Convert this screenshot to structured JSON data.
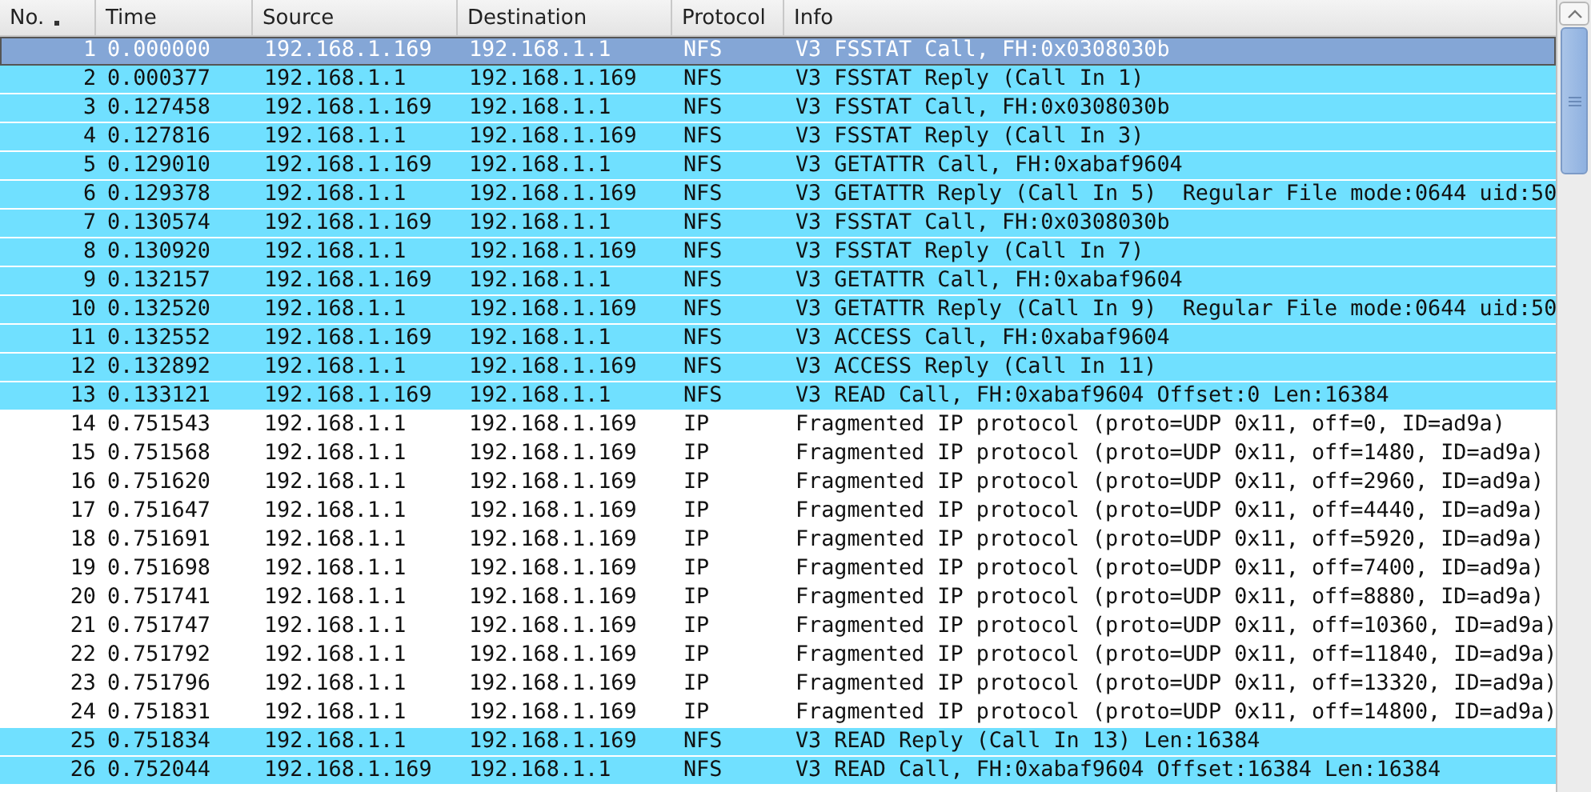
{
  "table": {
    "columns": [
      {
        "label": "No.",
        "sorted": true
      },
      {
        "label": "Time",
        "sorted": false
      },
      {
        "label": "Source",
        "sorted": false
      },
      {
        "label": "Destination",
        "sorted": false
      },
      {
        "label": "Protocol",
        "sorted": false
      },
      {
        "label": "Info",
        "sorted": false
      }
    ],
    "rows": [
      {
        "no": "1",
        "time": "0.000000",
        "source": "192.168.1.169",
        "destination": "192.168.1.1",
        "protocol": "NFS",
        "info": "V3 FSSTAT Call, FH:0x0308030b",
        "color": "#84a6d6",
        "selected": true
      },
      {
        "no": "2",
        "time": "0.000377",
        "source": "192.168.1.1",
        "destination": "192.168.1.169",
        "protocol": "NFS",
        "info": "V3 FSSTAT Reply (Call In 1)",
        "color": "#70e0ff",
        "selected": false
      },
      {
        "no": "3",
        "time": "0.127458",
        "source": "192.168.1.169",
        "destination": "192.168.1.1",
        "protocol": "NFS",
        "info": "V3 FSSTAT Call, FH:0x0308030b",
        "color": "#70e0ff",
        "selected": false
      },
      {
        "no": "4",
        "time": "0.127816",
        "source": "192.168.1.1",
        "destination": "192.168.1.169",
        "protocol": "NFS",
        "info": "V3 FSSTAT Reply (Call In 3)",
        "color": "#70e0ff",
        "selected": false
      },
      {
        "no": "5",
        "time": "0.129010",
        "source": "192.168.1.169",
        "destination": "192.168.1.1",
        "protocol": "NFS",
        "info": "V3 GETATTR Call, FH:0xabaf9604",
        "color": "#70e0ff",
        "selected": false
      },
      {
        "no": "6",
        "time": "0.129378",
        "source": "192.168.1.1",
        "destination": "192.168.1.169",
        "protocol": "NFS",
        "info": "V3 GETATTR Reply (Call In 5)  Regular File mode:0644 uid:50",
        "color": "#70e0ff",
        "selected": false
      },
      {
        "no": "7",
        "time": "0.130574",
        "source": "192.168.1.169",
        "destination": "192.168.1.1",
        "protocol": "NFS",
        "info": "V3 FSSTAT Call, FH:0x0308030b",
        "color": "#70e0ff",
        "selected": false
      },
      {
        "no": "8",
        "time": "0.130920",
        "source": "192.168.1.1",
        "destination": "192.168.1.169",
        "protocol": "NFS",
        "info": "V3 FSSTAT Reply (Call In 7)",
        "color": "#70e0ff",
        "selected": false
      },
      {
        "no": "9",
        "time": "0.132157",
        "source": "192.168.1.169",
        "destination": "192.168.1.1",
        "protocol": "NFS",
        "info": "V3 GETATTR Call, FH:0xabaf9604",
        "color": "#70e0ff",
        "selected": false
      },
      {
        "no": "10",
        "time": "0.132520",
        "source": "192.168.1.1",
        "destination": "192.168.1.169",
        "protocol": "NFS",
        "info": "V3 GETATTR Reply (Call In 9)  Regular File mode:0644 uid:50",
        "color": "#70e0ff",
        "selected": false
      },
      {
        "no": "11",
        "time": "0.132552",
        "source": "192.168.1.169",
        "destination": "192.168.1.1",
        "protocol": "NFS",
        "info": "V3 ACCESS Call, FH:0xabaf9604",
        "color": "#70e0ff",
        "selected": false
      },
      {
        "no": "12",
        "time": "0.132892",
        "source": "192.168.1.1",
        "destination": "192.168.1.169",
        "protocol": "NFS",
        "info": "V3 ACCESS Reply (Call In 11)",
        "color": "#70e0ff",
        "selected": false
      },
      {
        "no": "13",
        "time": "0.133121",
        "source": "192.168.1.169",
        "destination": "192.168.1.1",
        "protocol": "NFS",
        "info": "V3 READ Call, FH:0xabaf9604 Offset:0 Len:16384",
        "color": "#70e0ff",
        "selected": false
      },
      {
        "no": "14",
        "time": "0.751543",
        "source": "192.168.1.1",
        "destination": "192.168.1.169",
        "protocol": "IP",
        "info": "Fragmented IP protocol (proto=UDP 0x11, off=0, ID=ad9a)",
        "color": "#ffffff",
        "selected": false
      },
      {
        "no": "15",
        "time": "0.751568",
        "source": "192.168.1.1",
        "destination": "192.168.1.169",
        "protocol": "IP",
        "info": "Fragmented IP protocol (proto=UDP 0x11, off=1480, ID=ad9a)",
        "color": "#ffffff",
        "selected": false
      },
      {
        "no": "16",
        "time": "0.751620",
        "source": "192.168.1.1",
        "destination": "192.168.1.169",
        "protocol": "IP",
        "info": "Fragmented IP protocol (proto=UDP 0x11, off=2960, ID=ad9a)",
        "color": "#ffffff",
        "selected": false
      },
      {
        "no": "17",
        "time": "0.751647",
        "source": "192.168.1.1",
        "destination": "192.168.1.169",
        "protocol": "IP",
        "info": "Fragmented IP protocol (proto=UDP 0x11, off=4440, ID=ad9a)",
        "color": "#ffffff",
        "selected": false
      },
      {
        "no": "18",
        "time": "0.751691",
        "source": "192.168.1.1",
        "destination": "192.168.1.169",
        "protocol": "IP",
        "info": "Fragmented IP protocol (proto=UDP 0x11, off=5920, ID=ad9a)",
        "color": "#ffffff",
        "selected": false
      },
      {
        "no": "19",
        "time": "0.751698",
        "source": "192.168.1.1",
        "destination": "192.168.1.169",
        "protocol": "IP",
        "info": "Fragmented IP protocol (proto=UDP 0x11, off=7400, ID=ad9a)",
        "color": "#ffffff",
        "selected": false
      },
      {
        "no": "20",
        "time": "0.751741",
        "source": "192.168.1.1",
        "destination": "192.168.1.169",
        "protocol": "IP",
        "info": "Fragmented IP protocol (proto=UDP 0x11, off=8880, ID=ad9a)",
        "color": "#ffffff",
        "selected": false
      },
      {
        "no": "21",
        "time": "0.751747",
        "source": "192.168.1.1",
        "destination": "192.168.1.169",
        "protocol": "IP",
        "info": "Fragmented IP protocol (proto=UDP 0x11, off=10360, ID=ad9a)",
        "color": "#ffffff",
        "selected": false
      },
      {
        "no": "22",
        "time": "0.751792",
        "source": "192.168.1.1",
        "destination": "192.168.1.169",
        "protocol": "IP",
        "info": "Fragmented IP protocol (proto=UDP 0x11, off=11840, ID=ad9a)",
        "color": "#ffffff",
        "selected": false
      },
      {
        "no": "23",
        "time": "0.751796",
        "source": "192.168.1.1",
        "destination": "192.168.1.169",
        "protocol": "IP",
        "info": "Fragmented IP protocol (proto=UDP 0x11, off=13320, ID=ad9a)",
        "color": "#ffffff",
        "selected": false
      },
      {
        "no": "24",
        "time": "0.751831",
        "source": "192.168.1.1",
        "destination": "192.168.1.169",
        "protocol": "IP",
        "info": "Fragmented IP protocol (proto=UDP 0x11, off=14800, ID=ad9a)",
        "color": "#ffffff",
        "selected": false
      },
      {
        "no": "25",
        "time": "0.751834",
        "source": "192.168.1.1",
        "destination": "192.168.1.169",
        "protocol": "NFS",
        "info": "V3 READ Reply (Call In 13) Len:16384",
        "color": "#70e0ff",
        "selected": false
      },
      {
        "no": "26",
        "time": "0.752044",
        "source": "192.168.1.169",
        "destination": "192.168.1.1",
        "protocol": "NFS",
        "info": "V3 READ Call, FH:0xabaf9604 Offset:16384 Len:16384",
        "color": "#70e0ff",
        "selected": false
      }
    ]
  }
}
